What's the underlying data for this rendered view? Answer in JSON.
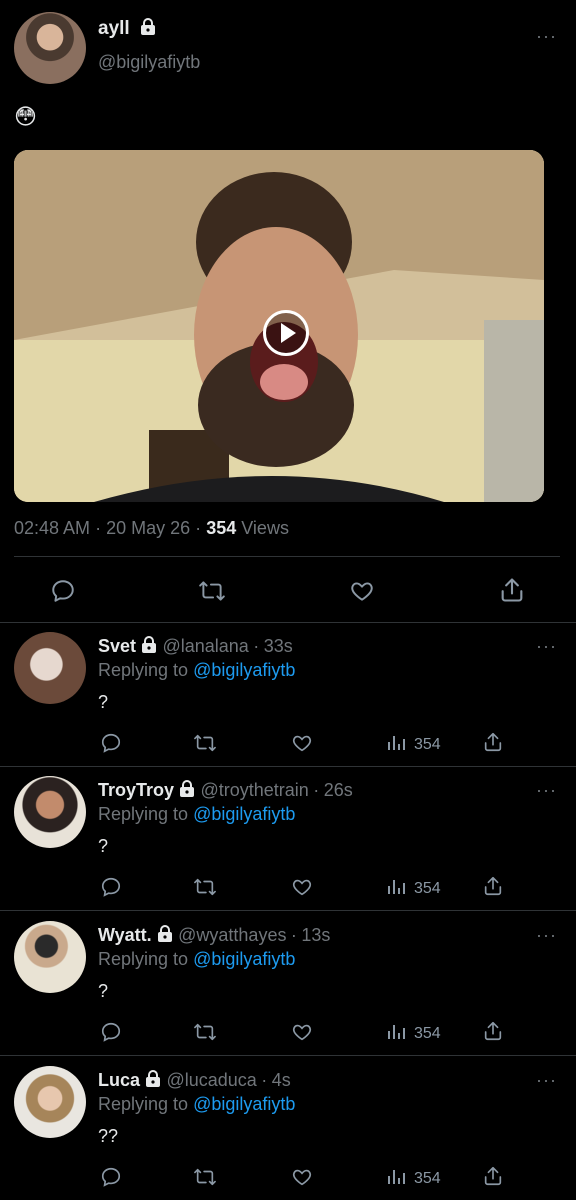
{
  "colors": {
    "background": "#000000",
    "text": "#e7e9ea",
    "muted": "#71767b",
    "accent": "#1d9bf0",
    "divider": "#2f3336"
  },
  "main_tweet": {
    "display_name": "ayll",
    "handle": "@bigilyafiytb",
    "text": "😳",
    "time": "02:48 AM",
    "date": "20 May 26",
    "views_count": "354",
    "views_label": "Views",
    "more": "···",
    "actions": [
      "reply-icon",
      "retweet-icon",
      "like-icon",
      "share-icon"
    ]
  },
  "replies": [
    {
      "name": "Svet",
      "handle": "@lanalana",
      "time": "33s",
      "replying_label": "Replying to",
      "replying_to": "@bigilyafiytb",
      "text": "?",
      "views": "354",
      "more": "···"
    },
    {
      "name": "TroyTroy",
      "handle": "@troythetrain",
      "time": "26s",
      "replying_label": "Replying to",
      "replying_to": "@bigilyafiytb",
      "text": "?",
      "views": "354",
      "more": "···"
    },
    {
      "name": "Wyatt.",
      "handle": "@wyatthayes",
      "time": "13s",
      "replying_label": "Replying to",
      "replying_to": "@bigilyafiytb",
      "text": "?",
      "views": "354",
      "more": "···"
    },
    {
      "name": "Luca",
      "handle": "@lucaduca",
      "time": "4s",
      "replying_label": "Replying to",
      "replying_to": "@bigilyafiytb",
      "text": "??",
      "views": "354",
      "more": "···"
    }
  ],
  "separator": "·"
}
